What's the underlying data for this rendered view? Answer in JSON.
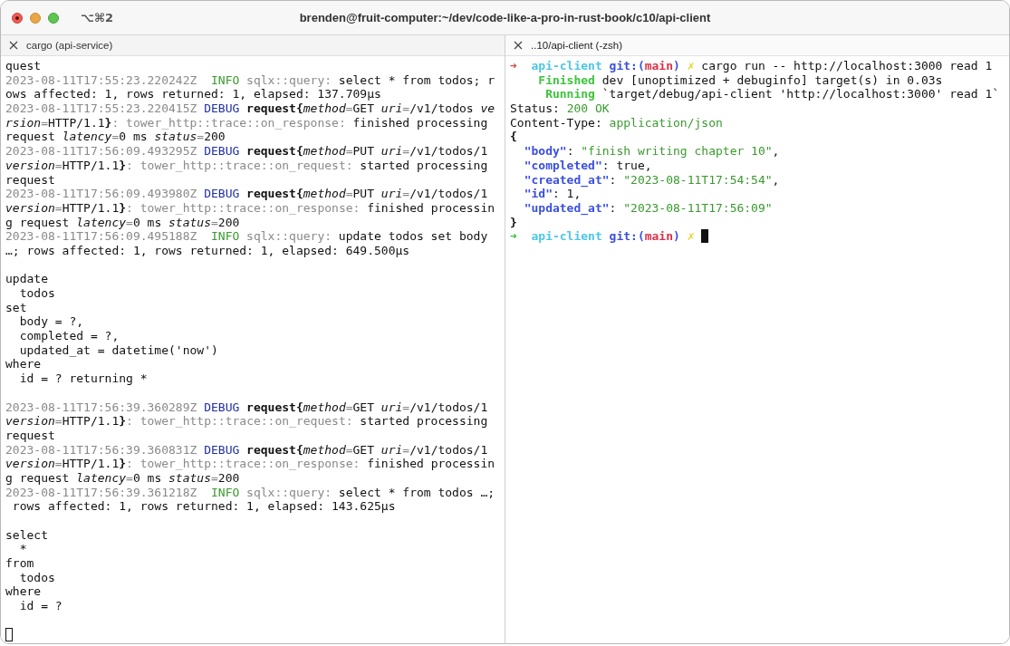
{
  "window": {
    "title": "brenden@fruit-computer:~/dev/code-like-a-pro-in-rust-book/c10/api-client",
    "shortcut": "⌥⌘2"
  },
  "panes": [
    {
      "tab": "cargo (api-service)",
      "focused": false,
      "lines": [
        {
          "segments": [
            {
              "kind": "plain",
              "text": "quest"
            }
          ]
        },
        {
          "segments": [
            {
              "kind": "dim",
              "text": "2023-08-11T17:55:23.220242Z  "
            },
            {
              "kind": "info",
              "text": "INFO"
            },
            {
              "kind": "dim",
              "text": " sqlx::query:"
            },
            {
              "kind": "plain",
              "text": " select * from todos; r"
            }
          ]
        },
        {
          "segments": [
            {
              "kind": "plain",
              "text": "ows affected: 1, rows returned: 1, elapsed: 137.709µs"
            }
          ]
        },
        {
          "segments": [
            {
              "kind": "dim",
              "text": "2023-08-11T17:55:23.220415Z "
            },
            {
              "kind": "debug",
              "text": "DEBUG"
            },
            {
              "kind": "bold",
              "text": " request{"
            },
            {
              "kind": "italic",
              "text": "method"
            },
            {
              "kind": "dim",
              "text": "="
            },
            {
              "kind": "plain",
              "text": "GET "
            },
            {
              "kind": "italic",
              "text": "uri"
            },
            {
              "kind": "dim",
              "text": "="
            },
            {
              "kind": "plain",
              "text": "/v1/todos "
            },
            {
              "kind": "italic",
              "text": "ve"
            }
          ]
        },
        {
          "segments": [
            {
              "kind": "italic",
              "text": "rsion"
            },
            {
              "kind": "dim",
              "text": "="
            },
            {
              "kind": "plain",
              "text": "HTTP/1.1"
            },
            {
              "kind": "bold",
              "text": "}"
            },
            {
              "kind": "dim",
              "text": ": tower_http::trace::on_response:"
            },
            {
              "kind": "plain",
              "text": " finished processing"
            }
          ]
        },
        {
          "segments": [
            {
              "kind": "plain",
              "text": "request "
            },
            {
              "kind": "italic",
              "text": "latency"
            },
            {
              "kind": "dim",
              "text": "="
            },
            {
              "kind": "plain",
              "text": "0 ms "
            },
            {
              "kind": "italic",
              "text": "status"
            },
            {
              "kind": "dim",
              "text": "="
            },
            {
              "kind": "plain",
              "text": "200"
            }
          ]
        },
        {
          "segments": [
            {
              "kind": "dim",
              "text": "2023-08-11T17:56:09.493295Z "
            },
            {
              "kind": "debug",
              "text": "DEBUG"
            },
            {
              "kind": "bold",
              "text": " request{"
            },
            {
              "kind": "italic",
              "text": "method"
            },
            {
              "kind": "dim",
              "text": "="
            },
            {
              "kind": "plain",
              "text": "PUT "
            },
            {
              "kind": "italic",
              "text": "uri"
            },
            {
              "kind": "dim",
              "text": "="
            },
            {
              "kind": "plain",
              "text": "/v1/todos/1"
            }
          ]
        },
        {
          "segments": [
            {
              "kind": "italic",
              "text": "version"
            },
            {
              "kind": "dim",
              "text": "="
            },
            {
              "kind": "plain",
              "text": "HTTP/1.1"
            },
            {
              "kind": "bold",
              "text": "}"
            },
            {
              "kind": "dim",
              "text": ": tower_http::trace::on_request:"
            },
            {
              "kind": "plain",
              "text": " started processing"
            }
          ]
        },
        {
          "segments": [
            {
              "kind": "plain",
              "text": "request"
            }
          ]
        },
        {
          "segments": [
            {
              "kind": "dim",
              "text": "2023-08-11T17:56:09.493980Z "
            },
            {
              "kind": "debug",
              "text": "DEBUG"
            },
            {
              "kind": "bold",
              "text": " request{"
            },
            {
              "kind": "italic",
              "text": "method"
            },
            {
              "kind": "dim",
              "text": "="
            },
            {
              "kind": "plain",
              "text": "PUT "
            },
            {
              "kind": "italic",
              "text": "uri"
            },
            {
              "kind": "dim",
              "text": "="
            },
            {
              "kind": "plain",
              "text": "/v1/todos/1"
            }
          ]
        },
        {
          "segments": [
            {
              "kind": "italic",
              "text": "version"
            },
            {
              "kind": "dim",
              "text": "="
            },
            {
              "kind": "plain",
              "text": "HTTP/1.1"
            },
            {
              "kind": "bold",
              "text": "}"
            },
            {
              "kind": "dim",
              "text": ": tower_http::trace::on_response:"
            },
            {
              "kind": "plain",
              "text": " finished processin"
            }
          ]
        },
        {
          "segments": [
            {
              "kind": "plain",
              "text": "g request "
            },
            {
              "kind": "italic",
              "text": "latency"
            },
            {
              "kind": "dim",
              "text": "="
            },
            {
              "kind": "plain",
              "text": "0 ms "
            },
            {
              "kind": "italic",
              "text": "status"
            },
            {
              "kind": "dim",
              "text": "="
            },
            {
              "kind": "plain",
              "text": "200"
            }
          ]
        },
        {
          "segments": [
            {
              "kind": "dim",
              "text": "2023-08-11T17:56:09.495188Z  "
            },
            {
              "kind": "info",
              "text": "INFO"
            },
            {
              "kind": "dim",
              "text": " sqlx::query:"
            },
            {
              "kind": "plain",
              "text": " update todos set body"
            }
          ]
        },
        {
          "segments": [
            {
              "kind": "plain",
              "text": "…; rows affected: 1, rows returned: 1, elapsed: 649.500µs"
            }
          ]
        },
        {
          "space_before": true,
          "segments": [
            {
              "kind": "plain",
              "text": "update"
            }
          ]
        },
        {
          "segments": [
            {
              "kind": "plain",
              "text": "  todos"
            }
          ]
        },
        {
          "segments": [
            {
              "kind": "plain",
              "text": "set"
            }
          ]
        },
        {
          "segments": [
            {
              "kind": "plain",
              "text": "  body = ?,"
            }
          ]
        },
        {
          "segments": [
            {
              "kind": "plain",
              "text": "  completed = ?,"
            }
          ]
        },
        {
          "segments": [
            {
              "kind": "plain",
              "text": "  updated_at = datetime('now')"
            }
          ]
        },
        {
          "segments": [
            {
              "kind": "plain",
              "text": "where"
            }
          ]
        },
        {
          "segments": [
            {
              "kind": "plain",
              "text": "  id = ? returning *"
            }
          ]
        },
        {
          "space_before": true,
          "segments": [
            {
              "kind": "dim",
              "text": "2023-08-11T17:56:39.360289Z "
            },
            {
              "kind": "debug",
              "text": "DEBUG"
            },
            {
              "kind": "bold",
              "text": " request{"
            },
            {
              "kind": "italic",
              "text": "method"
            },
            {
              "kind": "dim",
              "text": "="
            },
            {
              "kind": "plain",
              "text": "GET "
            },
            {
              "kind": "italic",
              "text": "uri"
            },
            {
              "kind": "dim",
              "text": "="
            },
            {
              "kind": "plain",
              "text": "/v1/todos/1"
            }
          ]
        },
        {
          "segments": [
            {
              "kind": "italic",
              "text": "version"
            },
            {
              "kind": "dim",
              "text": "="
            },
            {
              "kind": "plain",
              "text": "HTTP/1.1"
            },
            {
              "kind": "bold",
              "text": "}"
            },
            {
              "kind": "dim",
              "text": ": tower_http::trace::on_request:"
            },
            {
              "kind": "plain",
              "text": " started processing"
            }
          ]
        },
        {
          "segments": [
            {
              "kind": "plain",
              "text": "request"
            }
          ]
        },
        {
          "segments": [
            {
              "kind": "dim",
              "text": "2023-08-11T17:56:39.360831Z "
            },
            {
              "kind": "debug",
              "text": "DEBUG"
            },
            {
              "kind": "bold",
              "text": " request{"
            },
            {
              "kind": "italic",
              "text": "method"
            },
            {
              "kind": "dim",
              "text": "="
            },
            {
              "kind": "plain",
              "text": "GET "
            },
            {
              "kind": "italic",
              "text": "uri"
            },
            {
              "kind": "dim",
              "text": "="
            },
            {
              "kind": "plain",
              "text": "/v1/todos/1"
            }
          ]
        },
        {
          "segments": [
            {
              "kind": "italic",
              "text": "version"
            },
            {
              "kind": "dim",
              "text": "="
            },
            {
              "kind": "plain",
              "text": "HTTP/1.1"
            },
            {
              "kind": "bold",
              "text": "}"
            },
            {
              "kind": "dim",
              "text": ": tower_http::trace::on_response:"
            },
            {
              "kind": "plain",
              "text": " finished processin"
            }
          ]
        },
        {
          "segments": [
            {
              "kind": "plain",
              "text": "g request "
            },
            {
              "kind": "italic",
              "text": "latency"
            },
            {
              "kind": "dim",
              "text": "="
            },
            {
              "kind": "plain",
              "text": "0 ms "
            },
            {
              "kind": "italic",
              "text": "status"
            },
            {
              "kind": "dim",
              "text": "="
            },
            {
              "kind": "plain",
              "text": "200"
            }
          ]
        },
        {
          "segments": [
            {
              "kind": "dim",
              "text": "2023-08-11T17:56:39.361218Z  "
            },
            {
              "kind": "info",
              "text": "INFO"
            },
            {
              "kind": "dim",
              "text": " sqlx::query:"
            },
            {
              "kind": "plain",
              "text": " select * from todos …;"
            }
          ]
        },
        {
          "segments": [
            {
              "kind": "plain",
              "text": " rows affected: 1, rows returned: 1, elapsed: 143.625µs"
            }
          ]
        },
        {
          "space_before": true,
          "segments": [
            {
              "kind": "plain",
              "text": "select"
            }
          ]
        },
        {
          "segments": [
            {
              "kind": "plain",
              "text": "  *"
            }
          ]
        },
        {
          "segments": [
            {
              "kind": "plain",
              "text": "from"
            }
          ]
        },
        {
          "segments": [
            {
              "kind": "plain",
              "text": "  todos"
            }
          ]
        },
        {
          "segments": [
            {
              "kind": "plain",
              "text": "where"
            }
          ]
        },
        {
          "segments": [
            {
              "kind": "plain",
              "text": "  id = ?"
            }
          ]
        },
        {
          "space_before": true,
          "cursor": {
            "kind": "hollow"
          }
        }
      ]
    },
    {
      "tab": "..10/api-client (-zsh)",
      "focused": true,
      "lines": [
        {
          "segments": [
            {
              "kind": "prompt_err",
              "text": "➜"
            },
            {
              "kind": "dir",
              "text": "  api-client"
            },
            {
              "kind": "git",
              "text": " git:("
            },
            {
              "kind": "branch",
              "text": "main"
            },
            {
              "kind": "git",
              "text": ")"
            },
            {
              "kind": "dirty",
              "text": " ✗"
            },
            {
              "kind": "plain",
              "text": " cargo run -- http://localhost:3000 read 1"
            }
          ]
        },
        {
          "segments": [
            {
              "kind": "cargo",
              "text": "    Finished"
            },
            {
              "kind": "plain",
              "text": " dev [unoptimized + debuginfo] target(s) in 0.03s"
            }
          ]
        },
        {
          "segments": [
            {
              "kind": "cargo",
              "text": "     Running"
            },
            {
              "kind": "plain",
              "text": " `target/debug/api-client 'http://localhost:3000' read 1`"
            }
          ]
        },
        {
          "segments": [
            {
              "kind": "plain",
              "text": "Status: "
            },
            {
              "kind": "string",
              "text": "200 OK"
            }
          ]
        },
        {
          "segments": [
            {
              "kind": "plain",
              "text": "Content-Type: "
            },
            {
              "kind": "string",
              "text": "application/json"
            }
          ]
        },
        {
          "segments": [
            {
              "kind": "bold",
              "text": "{"
            }
          ]
        },
        {
          "segments": [
            {
              "kind": "key",
              "text": "  \"body\""
            },
            {
              "kind": "plain",
              "text": ": "
            },
            {
              "kind": "string",
              "text": "\"finish writing chapter 10\""
            },
            {
              "kind": "plain",
              "text": ","
            }
          ]
        },
        {
          "segments": [
            {
              "kind": "key",
              "text": "  \"completed\""
            },
            {
              "kind": "plain",
              "text": ": true,"
            }
          ]
        },
        {
          "segments": [
            {
              "kind": "key",
              "text": "  \"created_at\""
            },
            {
              "kind": "plain",
              "text": ": "
            },
            {
              "kind": "string",
              "text": "\"2023-08-11T17:54:54\""
            },
            {
              "kind": "plain",
              "text": ","
            }
          ]
        },
        {
          "segments": [
            {
              "kind": "key",
              "text": "  \"id\""
            },
            {
              "kind": "plain",
              "text": ": 1,"
            }
          ]
        },
        {
          "segments": [
            {
              "kind": "key",
              "text": "  \"updated_at\""
            },
            {
              "kind": "plain",
              "text": ": "
            },
            {
              "kind": "string",
              "text": "\"2023-08-11T17:56:09\""
            }
          ]
        },
        {
          "segments": [
            {
              "kind": "bold",
              "text": "}"
            }
          ]
        },
        {
          "cursor": {
            "kind": "block"
          },
          "segments": [
            {
              "kind": "prompt_ok",
              "text": "➜"
            },
            {
              "kind": "dir",
              "text": "  api-client"
            },
            {
              "kind": "git",
              "text": " git:("
            },
            {
              "kind": "branch",
              "text": "main"
            },
            {
              "kind": "git",
              "text": ")"
            },
            {
              "kind": "dirty",
              "text": " ✗"
            }
          ]
        }
      ]
    }
  ]
}
